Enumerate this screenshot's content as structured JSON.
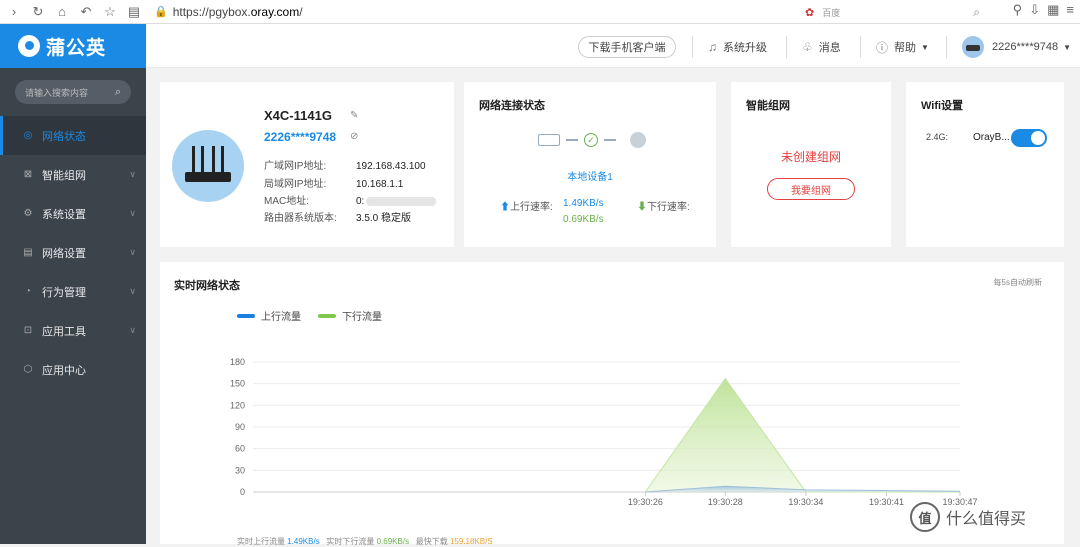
{
  "browser": {
    "url_prefix": "https://pgybox.",
    "url_host": "oray.com",
    "url_suffix": "/",
    "search_engine": "百度",
    "search_placeholder": "百度"
  },
  "header": {
    "logo": "蒲公英",
    "download_button": "下载手机客户端",
    "system_upgrade": "系统升级",
    "messages": "消息",
    "help": "帮助",
    "user": "2226****9748"
  },
  "sidebar": {
    "search_placeholder": "请输入搜索内容",
    "items": [
      {
        "label": "网络状态",
        "icon": "status-icon"
      },
      {
        "label": "智能组网",
        "icon": "mesh-icon"
      },
      {
        "label": "系统设置",
        "icon": "settings-icon"
      },
      {
        "label": "网络设置",
        "icon": "network-icon"
      },
      {
        "label": "行为管理",
        "icon": "behavior-icon"
      },
      {
        "label": "应用工具",
        "icon": "tools-icon"
      },
      {
        "label": "应用中心",
        "icon": "app-center-icon"
      }
    ]
  },
  "device": {
    "name": "X4C-1141G",
    "account": "2226****9748",
    "wan_label": "广域网IP地址:",
    "wan_value": "192.168.43.100",
    "lan_label": "局域网IP地址:",
    "lan_value": "10.168.1.1",
    "mac_label": "MAC地址:",
    "mac_value": "0:",
    "version_label": "路由器系统版本:",
    "version_value": "3.5.0 稳定版"
  },
  "network": {
    "title": "网络连接状态",
    "local_device": "本地设备1",
    "up_label": "上行速率:",
    "up_value": "1.49KB/s",
    "down_label": "下行速率:",
    "down_value": "0.69KB/s"
  },
  "mesh": {
    "title": "智能组网",
    "empty_text": "未创建组网",
    "button": "我要组网"
  },
  "wifi": {
    "title": "Wifi设置",
    "band": "2.4G:",
    "ssid": "OrayB...",
    "enabled": true
  },
  "realtime": {
    "title": "实时网络状态",
    "refresh_note": "每5s自动刷新",
    "bottom_up_label": "实时上行流量",
    "bottom_up_value": "1.49KB/s",
    "bottom_down_label": "实时下行流量",
    "bottom_down_value": "0.69KB/s",
    "bottom_peak_label": "最快下载",
    "bottom_peak_value": "159.18KB/S"
  },
  "watermark": "什么值得买",
  "colors": {
    "brand": "#1a8ae4",
    "upload": "#1a7fe0",
    "download": "#7ec84a",
    "danger": "#e54040"
  },
  "chart_data": {
    "type": "area",
    "x": [
      "19:30:26",
      "19:30:28",
      "19:30:34",
      "19:30:41",
      "19:30:47"
    ],
    "ylim": [
      0,
      180
    ],
    "yticks": [
      0,
      30,
      60,
      90,
      120,
      150,
      180
    ],
    "series": [
      {
        "name": "上行流量",
        "values": [
          0,
          8,
          3,
          2,
          1
        ]
      },
      {
        "name": "下行流量",
        "values": [
          0,
          157,
          0,
          0,
          0
        ]
      }
    ]
  }
}
